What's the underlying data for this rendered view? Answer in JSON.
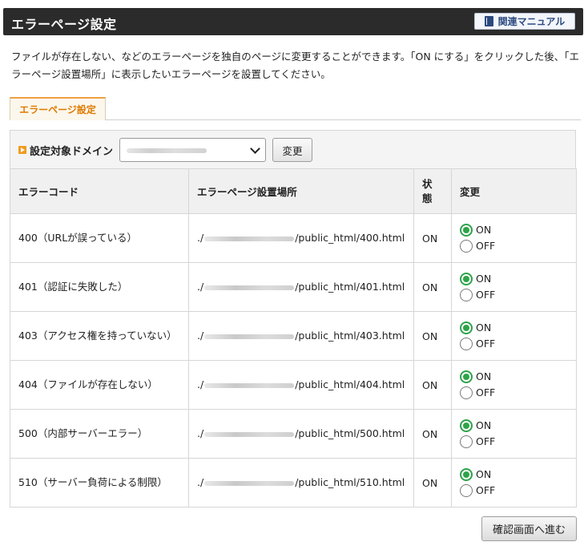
{
  "header": {
    "title": "エラーページ設定",
    "manual_button": "関連マニュアル",
    "manual_icon": "book-icon"
  },
  "description": "ファイルが存在しない、などのエラーページを独自のページに変更することができます。「ON にする」をクリックした後、「エラーページ設置場所」に表示したいエラーページを設置してください。",
  "tab": {
    "label": "エラーページ設定"
  },
  "domain_row": {
    "label": "設定対象ドメイン",
    "change_button": "変更"
  },
  "table": {
    "headers": {
      "code": "エラーコード",
      "location": "エラーページ設置場所",
      "state": "状\n態",
      "change": "変更"
    },
    "on_label": "ON",
    "off_label": "OFF",
    "rows": [
      {
        "code": "400（URLが誤っている）",
        "path_prefix": "./",
        "path_suffix": "/public_html/400.html",
        "state": "ON",
        "selected": "ON"
      },
      {
        "code": "401（認証に失敗した）",
        "path_prefix": "./",
        "path_suffix": "/public_html/401.html",
        "state": "ON",
        "selected": "ON"
      },
      {
        "code": "403（アクセス権を持っていない）",
        "path_prefix": "./",
        "path_suffix": "/public_html/403.html",
        "state": "ON",
        "selected": "ON"
      },
      {
        "code": "404（ファイルが存在しない）",
        "path_prefix": "./",
        "path_suffix": "/public_html/404.html",
        "state": "ON",
        "selected": "ON"
      },
      {
        "code": "500（内部サーバーエラー）",
        "path_prefix": "./",
        "path_suffix": "/public_html/500.html",
        "state": "ON",
        "selected": "ON"
      },
      {
        "code": "510（サーバー負荷による制限）",
        "path_prefix": "./",
        "path_suffix": "/public_html/510.html",
        "state": "ON",
        "selected": "ON"
      }
    ]
  },
  "footer": {
    "confirm_button": "確認画面へ進む"
  },
  "colors": {
    "accent_orange": "#f29a1f",
    "radio_green": "#2ea34a",
    "header_bg": "#2b2b2b"
  }
}
